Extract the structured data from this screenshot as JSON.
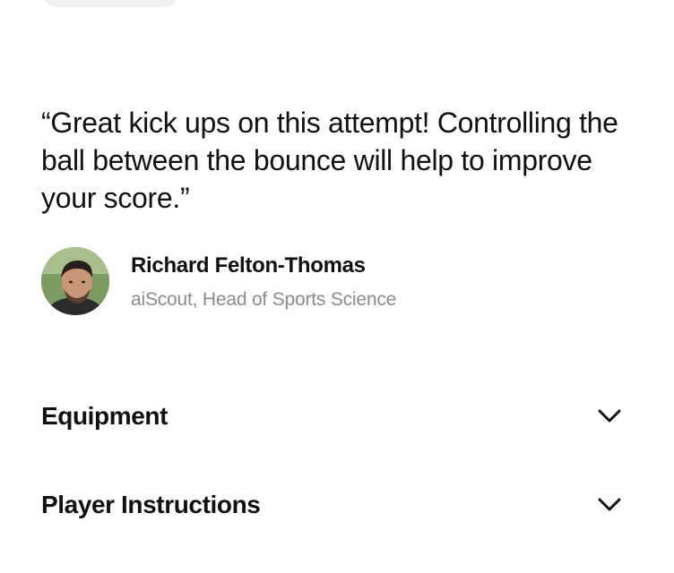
{
  "testimonial": {
    "quote": "“Great kick ups on this attempt! Controlling the ball between the bounce will help to improve your score.”",
    "author_name": "Richard Felton-Thomas",
    "author_role": "aiScout, Head of Sports Science"
  },
  "accordion": [
    {
      "label": "Equipment",
      "icon": "chevron-down-icon"
    },
    {
      "label": "Player Instructions",
      "icon": "chevron-down-icon"
    }
  ],
  "colors": {
    "text": "#111111",
    "subtext": "#8c8c8c",
    "background": "#ffffff",
    "pill": "#f1f1f1"
  }
}
